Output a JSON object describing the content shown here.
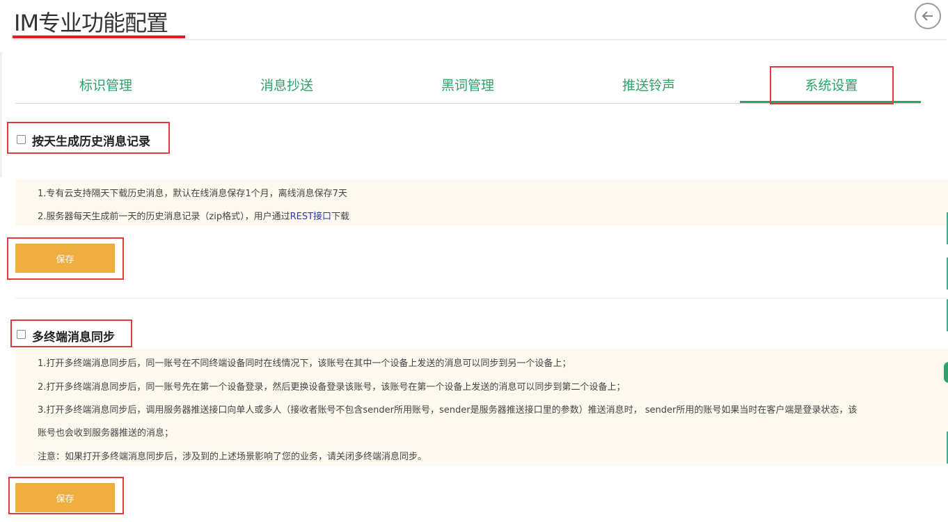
{
  "page": {
    "title": "IM专业功能配置"
  },
  "tabs": [
    {
      "label": "标识管理"
    },
    {
      "label": "消息抄送"
    },
    {
      "label": "黑词管理"
    },
    {
      "label": "推送铃声"
    },
    {
      "label": "系统设置",
      "active": true
    }
  ],
  "section_history": {
    "checkbox_checked": false,
    "title": "按天生成历史消息记录",
    "notes": {
      "line1": "1.专有云支持隔天下载历史消息，默认在线消息保存1个月，离线消息保存7天",
      "line2_before": "2.服务器每天生成前一天的历史消息记录（zip格式），用户通过",
      "line2_link": "REST接口",
      "line2_after": "下载"
    },
    "save_label": "保存"
  },
  "section_sync": {
    "checkbox_checked": false,
    "title": "多终端消息同步",
    "notes": {
      "line1": "1.打开多终端消息同步后，同一账号在不同终端设备同时在线情况下，该账号在其中一个设备上发送的消息可以同步到另一个设备上；",
      "line2": "2.打开多终端消息同步后，同一账号先在第一个设备登录，然后更换设备登录该账号，该账号在第一个设备上发送的消息可以同步到第二个设备上；",
      "line3": "3.打开多终端消息同步后，调用服务器推送接口向单人或多人（接收者账号不包含sender所用账号，sender是服务器推送接口里的参数）推送消息时， sender所用的账号如果当时在客户端是登录状态，该",
      "line4": "账号也会收到服务器推送的消息；",
      "notice": "注意：如果打开多终端消息同步后，涉及到的上述场景影响了您的业务，请关闭多终端消息同步。"
    },
    "save_label": "保存"
  },
  "icons": {
    "back": "back-arrow-icon"
  },
  "colors": {
    "tab_text": "#2aa36a",
    "save_button": "#f0ad40",
    "highlight": "#e03a3a",
    "note_bg": "#fdf9ef",
    "title_underline": "#e02020"
  }
}
